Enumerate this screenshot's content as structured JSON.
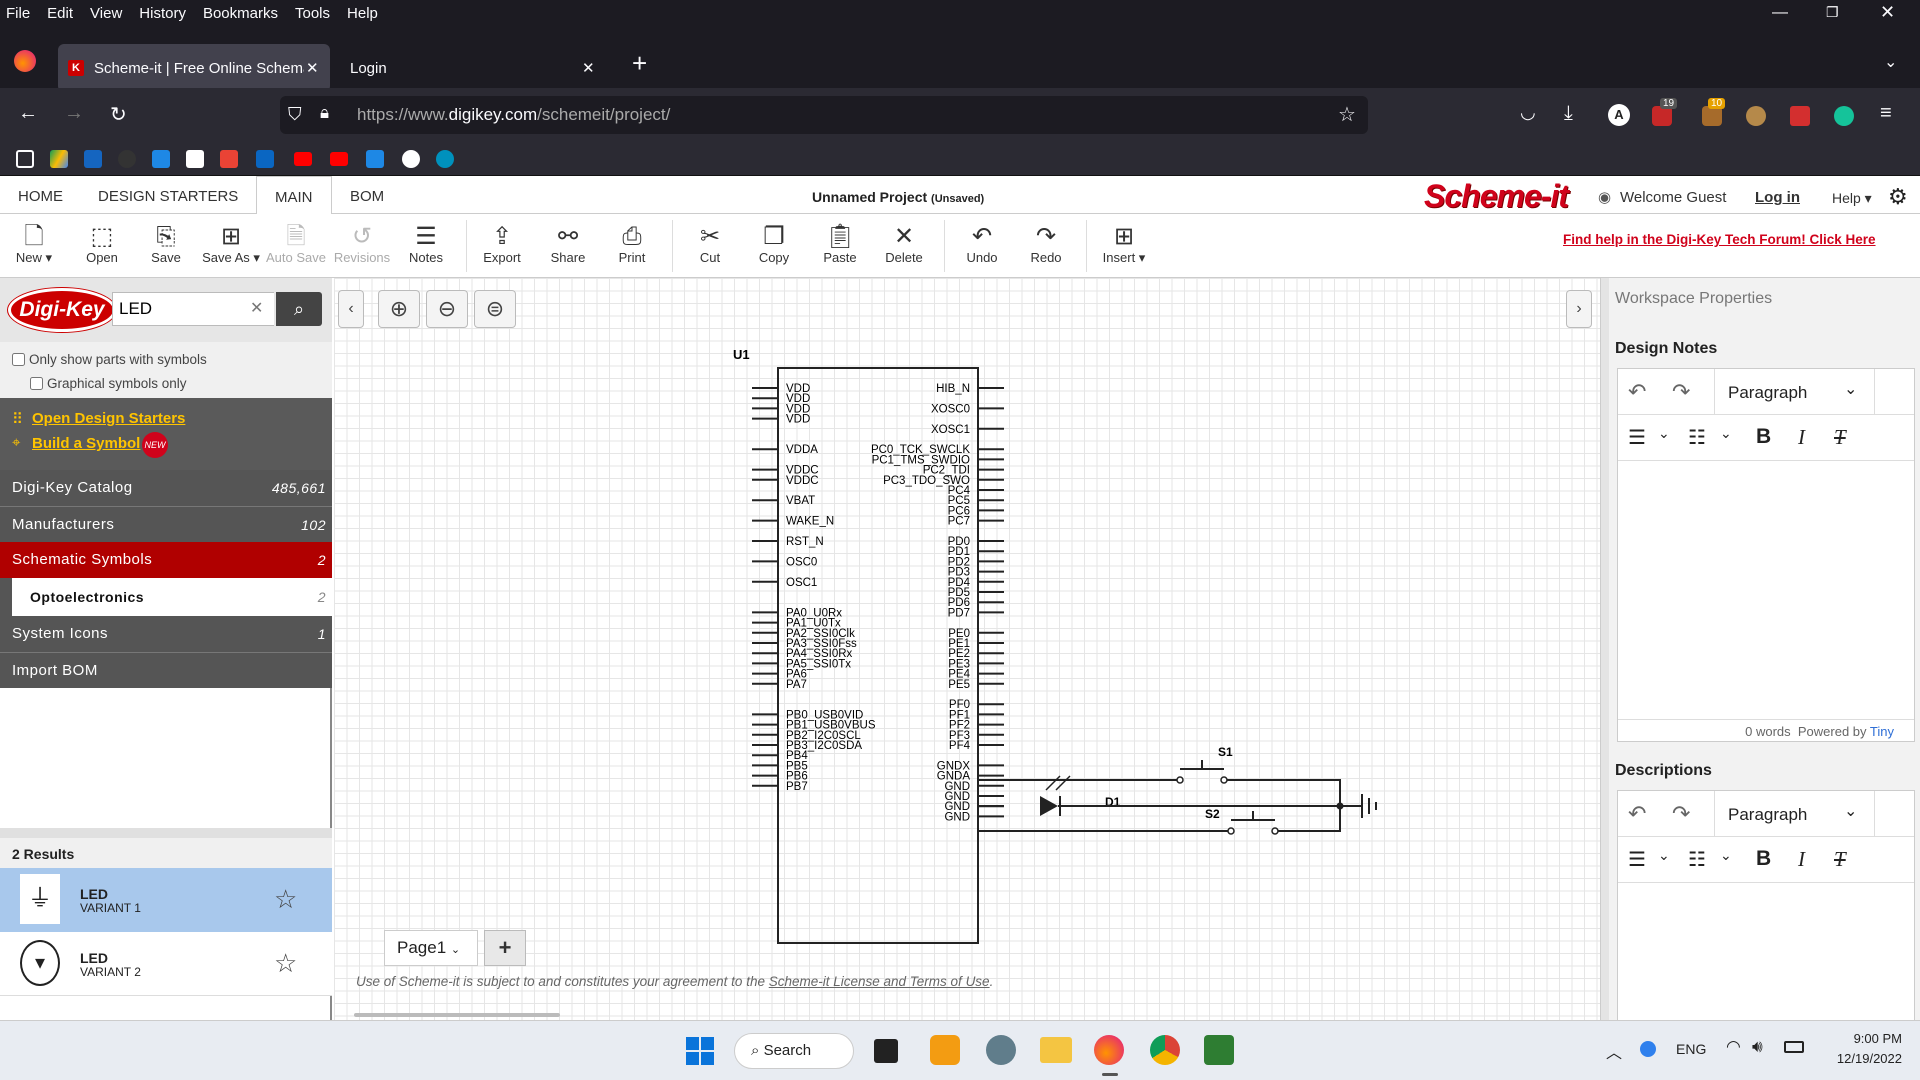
{
  "browser": {
    "menu": [
      "File",
      "Edit",
      "View",
      "History",
      "Bookmarks",
      "Tools",
      "Help"
    ],
    "tabs": [
      {
        "label": "Scheme-it | Free Online Schema",
        "active": true
      },
      {
        "label": "Login",
        "active": false
      }
    ],
    "url_prefix": "https://www.",
    "url_domain": "digikey.com",
    "url_path": "/schemeit/project/",
    "badge_counts": {
      "ext1": "19",
      "ext2": "10"
    },
    "account_letter": "A"
  },
  "app": {
    "nav_tabs": [
      "HOME",
      "DESIGN STARTERS",
      "MAIN",
      "BOM"
    ],
    "active_tab": "MAIN",
    "project_title": "Unnamed Project",
    "project_status": "(Unsaved)",
    "logo_text": "Scheme-it",
    "welcome": "Welcome Guest",
    "login": "Log in",
    "help": "Help",
    "forum_link": "Find help in the Digi-Key Tech Forum! Click Here",
    "toolbar": {
      "new": "New",
      "open": "Open",
      "save": "Save",
      "save_as": "Save As",
      "auto_save": "Auto Save",
      "revisions": "Revisions",
      "notes": "Notes",
      "export": "Export",
      "share": "Share",
      "print": "Print",
      "cut": "Cut",
      "copy": "Copy",
      "paste": "Paste",
      "delete": "Delete",
      "undo": "Undo",
      "redo": "Redo",
      "insert": "Insert"
    }
  },
  "left": {
    "logo_text": "Digi-Key",
    "search_value": "LED",
    "only_symbols": "Only show parts with symbols",
    "graphical_only": "Graphical symbols only",
    "open_starters": "Open Design Starters",
    "build_symbol": "Build a Symbol",
    "new_badge": "NEW",
    "categories": [
      {
        "label": "Digi-Key Catalog",
        "count": "485,661"
      },
      {
        "label": "Manufacturers",
        "count": "102"
      },
      {
        "label": "Schematic Symbols",
        "count": "2"
      },
      {
        "label": "Optoelectronics",
        "count": "2"
      },
      {
        "label": "System Icons",
        "count": "1"
      },
      {
        "label": "Import BOM",
        "count": ""
      }
    ],
    "results_label": "2 Results",
    "results": [
      {
        "name": "LED",
        "variant": "VARIANT 1"
      },
      {
        "name": "LED",
        "variant": "VARIANT 2"
      }
    ]
  },
  "canvas": {
    "page_tab": "Page1",
    "terms_prefix": "Use of Scheme-it is subject to and constitutes your agreement to the ",
    "terms_link": "Scheme-it License and Terms of Use",
    "terms_suffix": ".",
    "ic_label": "U1",
    "left_pins": [
      "VDD",
      "VDD",
      "VDD",
      "VDD",
      "VDDA",
      "VDDC",
      "VDDC",
      "VBAT",
      "WAKE_N",
      "RST_N",
      "OSC0",
      "OSC1",
      "PA0_U0Rx",
      "PA1_U0Tx",
      "PA2_SSI0Clk",
      "PA3_SSI0Fss",
      "PA4_SSI0Rx",
      "PA5_SSI0Tx",
      "PA6",
      "PA7",
      "PB0_USB0VID",
      "PB1_USB0VBUS",
      "PB2_I2C0SCL",
      "PB3_I2C0SDA",
      "PB4",
      "PB5",
      "PB6",
      "PB7"
    ],
    "right_pins": [
      "HIB_N",
      "XOSC0",
      "XOSC1",
      "PC0_TCK_SWCLK",
      "PC1_TMS_SWDIO",
      "PC2_TDI",
      "PC3_TDO_SWO",
      "PC4",
      "PC5",
      "PC6",
      "PC7",
      "PD0",
      "PD1",
      "PD2",
      "PD3",
      "PD4",
      "PD5",
      "PD6",
      "PD7",
      "PE0",
      "PE1",
      "PE2",
      "PE3",
      "PE4",
      "PE5",
      "PF0",
      "PF1",
      "PF2",
      "PF3",
      "PF4",
      "GNDX",
      "GNDA",
      "GND",
      "GND",
      "GND",
      "GND"
    ],
    "d1": "D1",
    "s1": "S1",
    "s2": "S2"
  },
  "right": {
    "title": "Workspace Properties",
    "design_notes": "Design Notes",
    "paragraph": "Paragraph",
    "word_count": "0 words",
    "powered_by": "Powered by",
    "tiny": "Tiny",
    "descriptions": "Descriptions"
  },
  "taskbar": {
    "search": "Search",
    "lang": "ENG",
    "time": "9:00 PM",
    "date": "12/19/2022"
  }
}
